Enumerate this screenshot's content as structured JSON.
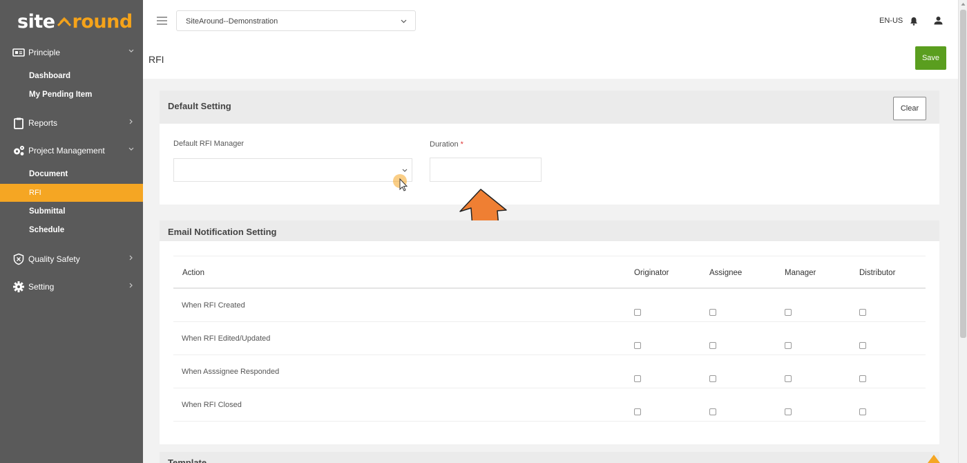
{
  "brand": {
    "part1": "site",
    "part2": "round"
  },
  "sidebar": {
    "groups": [
      {
        "label": "Principle",
        "icon": "id-card-icon",
        "expanded": true,
        "items": [
          "Dashboard",
          "My Pending Item"
        ]
      },
      {
        "label": "Reports",
        "icon": "clipboard-icon",
        "expanded": false,
        "items": []
      },
      {
        "label": "Project Management",
        "icon": "gears-icon",
        "expanded": true,
        "items": [
          "Document",
          "RFI",
          "Submittal",
          "Schedule"
        ]
      },
      {
        "label": "Quality Safety",
        "icon": "shield-icon",
        "expanded": false,
        "items": []
      },
      {
        "label": "Setting",
        "icon": "gear-icon",
        "expanded": false,
        "items": []
      }
    ],
    "active_item": "RFI",
    "accent_color": "#f5a623"
  },
  "topbar": {
    "project": "SiteAround--Demonstration",
    "language": "EN-US"
  },
  "page": {
    "title": "RFI",
    "save_label": "Save"
  },
  "default_setting": {
    "title": "Default Setting",
    "clear_label": "Clear",
    "manager_label": "Default RFI Manager",
    "manager_value": "",
    "duration_label": "Duration",
    "duration_required": "*",
    "duration_value": ""
  },
  "email_notification": {
    "title": "Email Notification Setting",
    "columns": [
      "Action",
      "Originator",
      "Assignee",
      "Manager",
      "Distributor"
    ],
    "rows": [
      {
        "action": "When RFI Created",
        "checks": [
          false,
          false,
          false,
          false
        ]
      },
      {
        "action": "When RFI Edited/Updated",
        "checks": [
          false,
          false,
          false,
          false
        ]
      },
      {
        "action": "When Asssignee Responded",
        "checks": [
          false,
          false,
          false,
          false
        ]
      },
      {
        "action": "When RFI Closed",
        "checks": [
          false,
          false,
          false,
          false
        ]
      }
    ]
  },
  "template": {
    "title": "Template"
  },
  "colors": {
    "save": "#5a9e1f",
    "sidebar": "#5a5a5a",
    "arrow": "#ef7f33"
  }
}
